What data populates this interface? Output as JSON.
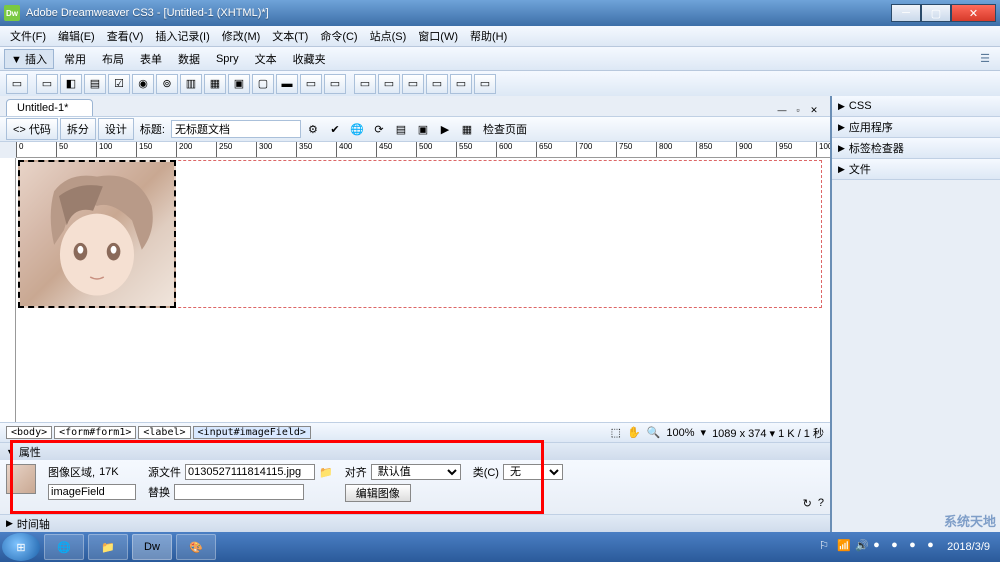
{
  "titlebar": {
    "app_icon_text": "Dw",
    "title": "Adobe Dreamweaver CS3 - [Untitled-1 (XHTML)*]"
  },
  "menu": {
    "items": [
      "文件(F)",
      "编辑(E)",
      "查看(V)",
      "插入记录(I)",
      "修改(M)",
      "文本(T)",
      "命令(C)",
      "站点(S)",
      "窗口(W)",
      "帮助(H)"
    ]
  },
  "insertbar": {
    "label": "▼ 插入",
    "tabs": [
      "常用",
      "布局",
      "表单",
      "数据",
      "Spry",
      "文本",
      "收藏夹"
    ]
  },
  "doc_tab": {
    "name": "Untitled-1*"
  },
  "viewbar": {
    "code": "代码",
    "split_btn": "拆分",
    "design": "设计",
    "title_label": "标题:",
    "title_value": "无标题文档",
    "check_page": "检查页面"
  },
  "ruler": {
    "marks": [
      "0",
      "50",
      "100",
      "150",
      "200",
      "250",
      "300",
      "350",
      "400",
      "450",
      "500",
      "550",
      "600",
      "650",
      "700",
      "750",
      "800",
      "850",
      "900",
      "950",
      "1000"
    ]
  },
  "tag_selector": {
    "tags": [
      "<body>",
      "<form#form1>",
      "<label>",
      "<input#imageField>"
    ]
  },
  "status": {
    "zoom": "100%",
    "dims": "1089 x 374 ▾ 1 K / 1 秒"
  },
  "props": {
    "header": "属性",
    "region_label": "图像区域,",
    "region_size": "17K",
    "id_value": "imageField",
    "src_label": "源文件",
    "src_value": "0130527111814115.jpg",
    "alt_label": "替换",
    "alt_value": "",
    "align_label": "对齐",
    "align_value": "默认值",
    "class_label": "类(C)",
    "class_value": "无",
    "edit_btn": "编辑图像"
  },
  "timeline": {
    "label": "时间轴"
  },
  "right_panels": {
    "items": [
      "CSS",
      "应用程序",
      "标签检查器",
      "文件"
    ]
  },
  "taskbar": {
    "date": "2018/3/9"
  },
  "watermark_text": "系统天地"
}
